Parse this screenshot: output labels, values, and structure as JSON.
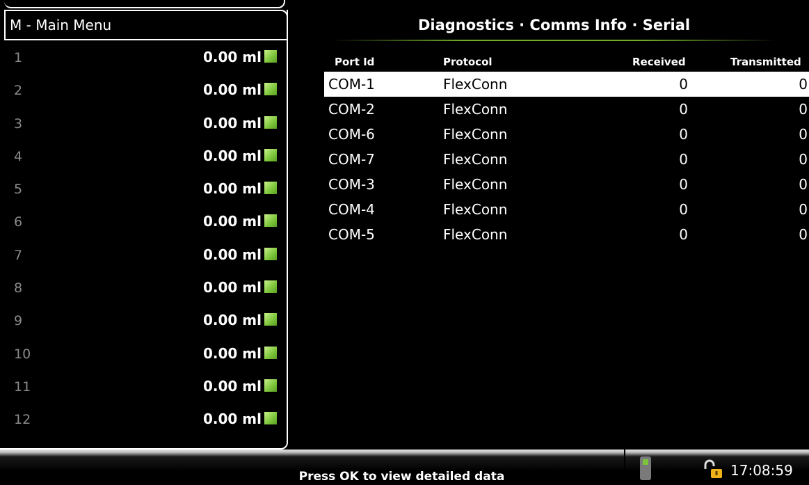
{
  "menu": {
    "title": "M - Main Menu"
  },
  "pumps": [
    {
      "num": "1",
      "volume": "0.00 ml"
    },
    {
      "num": "2",
      "volume": "0.00 ml"
    },
    {
      "num": "3",
      "volume": "0.00 ml"
    },
    {
      "num": "4",
      "volume": "0.00 ml"
    },
    {
      "num": "5",
      "volume": "0.00 ml"
    },
    {
      "num": "6",
      "volume": "0.00 ml"
    },
    {
      "num": "7",
      "volume": "0.00 ml"
    },
    {
      "num": "8",
      "volume": "0.00 ml"
    },
    {
      "num": "9",
      "volume": "0.00 ml"
    },
    {
      "num": "10",
      "volume": "0.00 ml"
    },
    {
      "num": "11",
      "volume": "0.00 ml"
    },
    {
      "num": "12",
      "volume": "0.00 ml"
    }
  ],
  "page": {
    "title": "Diagnostics · Comms Info · Serial"
  },
  "table": {
    "headers": {
      "port": "Port Id",
      "protocol": "Protocol",
      "received": "Received",
      "transmitted": "Transmitted"
    },
    "rows": [
      {
        "port": "COM-1",
        "protocol": "FlexConn",
        "received": "0",
        "transmitted": "0"
      },
      {
        "port": "COM-2",
        "protocol": "FlexConn",
        "received": "0",
        "transmitted": "0"
      },
      {
        "port": "COM-6",
        "protocol": "FlexConn",
        "received": "0",
        "transmitted": "0"
      },
      {
        "port": "COM-7",
        "protocol": "FlexConn",
        "received": "0",
        "transmitted": "0"
      },
      {
        "port": "COM-3",
        "protocol": "FlexConn",
        "received": "0",
        "transmitted": "0"
      },
      {
        "port": "COM-4",
        "protocol": "FlexConn",
        "received": "0",
        "transmitted": "0"
      },
      {
        "port": "COM-5",
        "protocol": "FlexConn",
        "received": "0",
        "transmitted": "0"
      }
    ]
  },
  "status": {
    "message": "Press OK to view detailed data",
    "time": "17:08:59"
  },
  "colors": {
    "led": "#7cc53a",
    "accent": "#6fae2b",
    "lock": "#f2b318"
  },
  "icons": {
    "device": "device-icon",
    "lock": "unlocked-padlock-icon"
  }
}
